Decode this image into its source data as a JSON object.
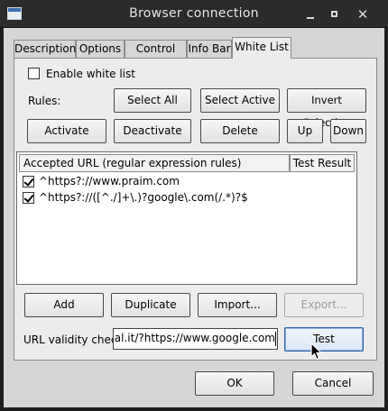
{
  "window": {
    "title": "Browser connection"
  },
  "tabs": [
    {
      "label": "Description",
      "active": false
    },
    {
      "label": "Options",
      "active": false
    },
    {
      "label": "Control Bar",
      "active": false
    },
    {
      "label": "Info Bar",
      "active": false
    },
    {
      "label": "White List",
      "active": true
    }
  ],
  "whitelist": {
    "enable_label": "Enable white list",
    "enable_checked": false,
    "rules_label": "Rules:",
    "select_all": "Select All",
    "select_active": "Select Active",
    "invert_selection": "Invert Selection",
    "activate": "Activate",
    "deactivate": "Deactivate",
    "delete": "Delete",
    "up": "Up",
    "down": "Down",
    "columns": [
      "Accepted URL (regular expression rules)",
      "Test Result"
    ],
    "rules": [
      {
        "checked": true,
        "url": "^https?://www.praim.com"
      },
      {
        "checked": true,
        "url": "^https?://([^./]+\\.)?google\\.com(/.*)?$"
      }
    ],
    "add": "Add",
    "duplicate": "Duplicate",
    "import": "Import...",
    "export": "Export...",
    "validity_label": "URL validity check",
    "validity_value": "al.it/?https://www.google.com",
    "test": "Test"
  },
  "footer": {
    "ok": "OK",
    "cancel": "Cancel"
  },
  "icons": {
    "app": "window-app-icon",
    "minimize": "minimize-icon",
    "maximize": "maximize-icon",
    "close": "close-icon",
    "cursor": "mouse-pointer-icon"
  }
}
